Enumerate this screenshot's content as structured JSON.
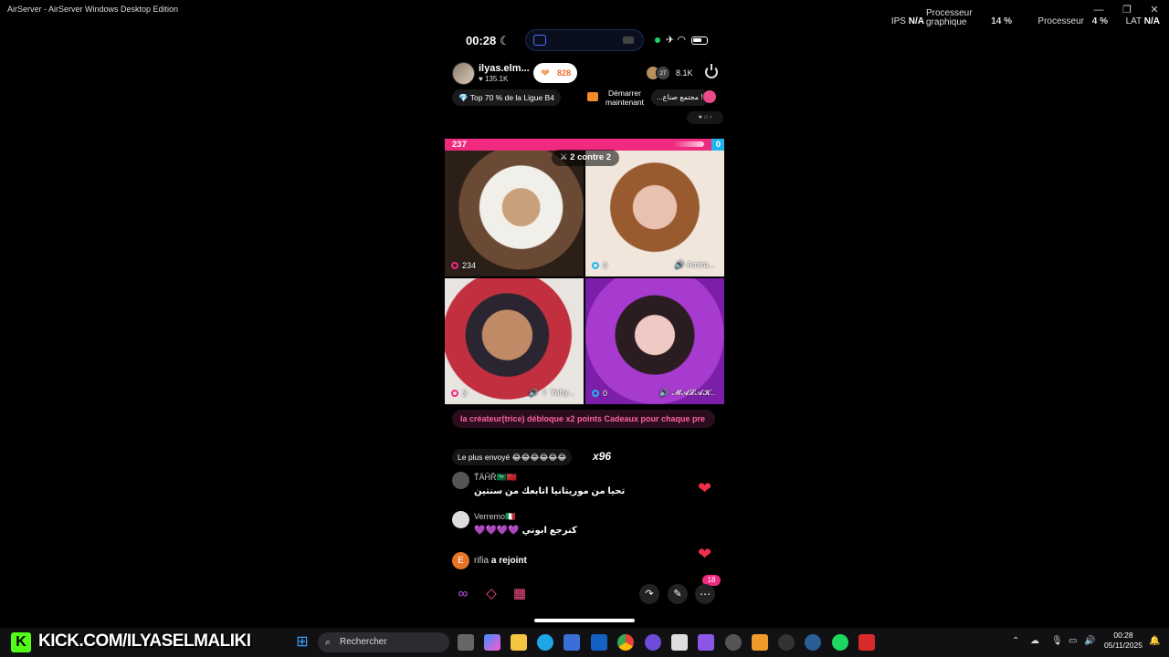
{
  "window": {
    "title": "AirServer - AirServer Windows Desktop Edition"
  },
  "stats": {
    "ips_label": "IPS",
    "ips_value": "N/A",
    "gpu_label": "Processeur graphique",
    "gpu_value": "14 %",
    "cpu_label": "Processeur",
    "cpu_value": "4 %",
    "lat_label": "LAT",
    "lat_value": "N/A"
  },
  "phone": {
    "clock": "00:28",
    "host": {
      "name": "ilyas.elm...",
      "likes": "♥ 135.1K",
      "follow_count": "828"
    },
    "viewers": {
      "count": "8.1K",
      "badge": "27"
    },
    "rank": "💎 Top 70 % de la Ligue B4",
    "start_live": "Démarrer maintenant",
    "community": "...مجتمع صناع !",
    "battle": {
      "left_score": "237",
      "right_score": "0",
      "mode": "2 contre 2"
    },
    "tiles": [
      {
        "score": "234",
        "name": ""
      },
      {
        "score": "0",
        "name": "🔊 Amira..."
      },
      {
        "score": "3",
        "name": "🔊 ✌ Yahy..."
      },
      {
        "score": "0",
        "name": "🔊 𝓜𝓐𝓛𝓐𝓚.."
      }
    ],
    "promo": "la créateur(trice) débloque x2 points Cadeaux pour chaque pre",
    "most_sent_label": "Le plus envoyé 😂😂😂😂😂😂",
    "most_sent_mult": "x96",
    "chat": [
      {
        "user": "ŤÄĤŘ🇸🇦🇲🇦",
        "text": "تحيا من موريتانيا اتابعك من سنتين"
      },
      {
        "user": "Verremo🇮🇹",
        "text": "💜💜💜💜 كنرجع ابوني"
      }
    ],
    "joined": {
      "initial": "E",
      "user": "rifia",
      "action": "a rejoint"
    },
    "notification_count": "18"
  },
  "overlay": {
    "kick_text": "KICK.COM/ILYASELMALIKI"
  },
  "taskbar": {
    "search_label": "Rechercher",
    "time": "00:28",
    "date": "05/11/2025"
  }
}
